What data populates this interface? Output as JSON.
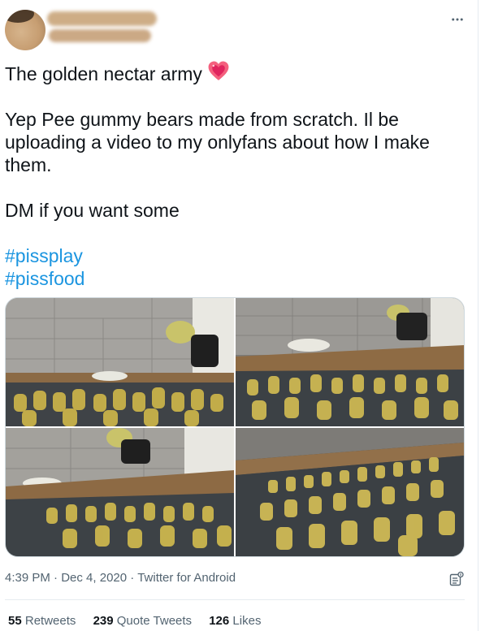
{
  "tweet": {
    "lines": {
      "l1": "The golden nectar army",
      "l2": "Yep Pee gummy bears made from scratch. Il be uploading a video to my onlyfans about how I make them.",
      "l3": "DM if you want some"
    },
    "hashtags": [
      "#pissplay",
      "#pissfood"
    ],
    "time": "4:39 PM",
    "date": "Dec 4, 2020",
    "source": "Twitter for Android",
    "sep": "·"
  },
  "stats": {
    "retweets": {
      "count": "55",
      "label": "Retweets"
    },
    "quotes": {
      "count": "239",
      "label": "Quote Tweets"
    },
    "likes": {
      "count": "126",
      "label": "Likes"
    }
  },
  "icons": {
    "more": "more-horizontal-icon",
    "heart": "sparkling-heart-emoji",
    "analytics": "analytics-icon"
  },
  "colors": {
    "link": "#1b95e0",
    "text": "#0f1419",
    "muted": "#536471"
  }
}
